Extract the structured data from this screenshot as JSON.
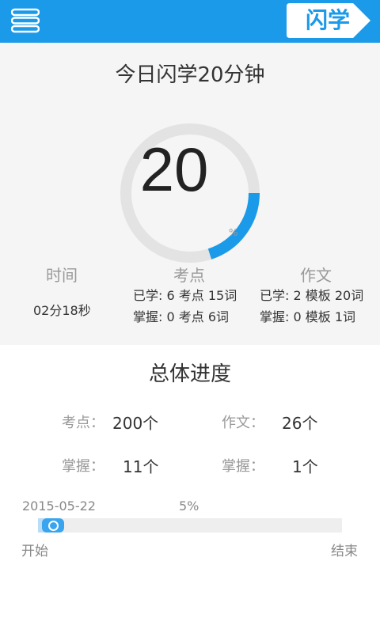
{
  "header": {
    "menu_icon": "hamburger-menu-icon",
    "logo_text": "闪学",
    "accent_color": "#1a9ae8"
  },
  "today": {
    "title": "今日闪学20分钟",
    "ring_value": "20",
    "ring_unit": "%",
    "ring_progress": 0.2,
    "time": {
      "label": "时间",
      "value": "02分18秒"
    },
    "kaodian": {
      "label": "考点",
      "learned": "已学: 6 考点 15词",
      "mastered": "掌握: 0 考点   6词"
    },
    "zuowen": {
      "label": "作文",
      "learned": "已学: 2 模板 20词",
      "mastered": "掌握: 0 模板   1词"
    }
  },
  "overall": {
    "title": "总体进度",
    "kaodian_label": "考点：",
    "kaodian_value": "200个",
    "zuowen_label": "作文：",
    "zuowen_value": "26个",
    "kaodian_mastered_label": "掌握：",
    "kaodian_mastered_value": "11个",
    "zuowen_mastered_label": "掌握：",
    "zuowen_mastered_value": "1个"
  },
  "progress": {
    "date": "2015-05-22",
    "percent_text": "5%",
    "fraction": 0.05,
    "start_label": "开始",
    "end_label": "结束"
  }
}
